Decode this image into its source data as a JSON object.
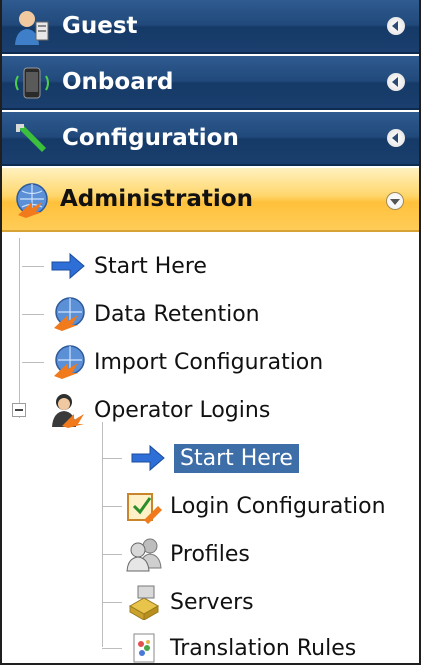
{
  "sections": {
    "guest": {
      "label": "Guest",
      "icon": "guest-user-icon"
    },
    "onboard": {
      "label": "Onboard",
      "icon": "mobile-device-icon"
    },
    "configuration": {
      "label": "Configuration",
      "icon": "wrench-icon"
    },
    "administration": {
      "label": "Administration",
      "icon": "globe-arrow-icon"
    }
  },
  "tree": {
    "start_here": "Start Here",
    "data_retention": "Data Retention",
    "import_configuration": "Import Configuration",
    "operator_logins": "Operator Logins",
    "children": {
      "start_here": "Start Here",
      "login_configuration": "Login Configuration",
      "profiles": "Profiles",
      "servers": "Servers",
      "translation_rules": "Translation Rules"
    }
  },
  "colors": {
    "header_blue": "#21497b",
    "active_gold": "#ffc13c",
    "selection": "#3d6ea8"
  }
}
